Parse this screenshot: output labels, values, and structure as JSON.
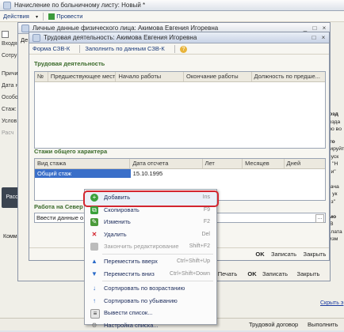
{
  "app": {
    "title": "Начисление по больничному листу: Новый *",
    "toolbar": {
      "actions": "Действия",
      "post": "Провести"
    },
    "left_labels": [
      "Входя",
      "Сотру",
      "Причи",
      "Дата н",
      "Особо",
      "Стаж:",
      "Услов",
      "Расч"
    ],
    "left_button": "Расс",
    "comment": "Комме",
    "status": "Трудовой договор",
    "status2": "Выполнить"
  },
  "right_texts": [
    "к созд",
    "х созда",
    "ожно во",
    "к что",
    "стрируйте",
    "Запуск",
    "ния \"Н",
    "ации\"",
    "ть задача",
    "ния ук",
    "ализ\" сло",
    "к смо",
    "0\". В",
    "арплата",
    "ка изм"
  ],
  "right_link": "Скрыть э",
  "phys_window": {
    "title": "Личные данные физического лица: Акимова Евгения Игоревна",
    "letter": "Де",
    "save": "Записать",
    "close": "Закрыть",
    "ok": "OK",
    "print": "Печать"
  },
  "labor_window": {
    "title": "Трудовая деятельность: Акимова Евгения Игоревна",
    "tabs": [
      "Форма СЗВ-К",
      "Заполнить по данным СЗВ-К"
    ],
    "section1": "Трудовая деятельность",
    "grid1_headers": [
      "№",
      "Предшествующее мест...",
      "Начало работы",
      "Окончание работы",
      "Должность по предше..."
    ],
    "section2": "Стажи общего характера",
    "grid2_headers": [
      "Вид стажа",
      "Дата отсчета",
      "Лет",
      "Месяцев",
      "Дней"
    ],
    "grid2_rows": [
      [
        "Общий стаж",
        "15.10.1995",
        "",
        "",
        ""
      ]
    ],
    "section3": "Работа на Север",
    "input_placeholder": "Ввести данные о ст",
    "ok": "OK",
    "save": "Записать",
    "close": "Закрыть"
  },
  "context_menu": {
    "items": [
      {
        "label": "Добавить",
        "shortcut": "Ins",
        "icon": "add-icon",
        "enabled": true
      },
      {
        "label": "Скопировать",
        "shortcut": "F9",
        "icon": "copy-icon",
        "enabled": true
      },
      {
        "label": "Изменить",
        "shortcut": "F2",
        "icon": "edit-icon",
        "enabled": true
      },
      {
        "label": "Удалить",
        "shortcut": "Del",
        "icon": "delete-icon",
        "enabled": true
      },
      {
        "label": "Закончить редактирование",
        "shortcut": "Shift+F2",
        "icon": "end-edit-icon",
        "enabled": false
      },
      {
        "label": "Переместить вверх",
        "shortcut": "Ctrl+Shift+Up",
        "icon": "move-up-icon",
        "enabled": true
      },
      {
        "label": "Переместить вниз",
        "shortcut": "Ctrl+Shift+Down",
        "icon": "move-down-icon",
        "enabled": true
      },
      {
        "label": "Сортировать по возрастанию",
        "shortcut": "",
        "icon": "sort-asc-icon",
        "enabled": true
      },
      {
        "label": "Сортировать по убыванию",
        "shortcut": "",
        "icon": "sort-desc-icon",
        "enabled": true
      },
      {
        "label": "Вывести список...",
        "shortcut": "",
        "icon": "list-icon",
        "enabled": true
      },
      {
        "label": "Настройка списка...",
        "shortcut": "",
        "icon": "settings-icon",
        "enabled": true
      }
    ]
  }
}
